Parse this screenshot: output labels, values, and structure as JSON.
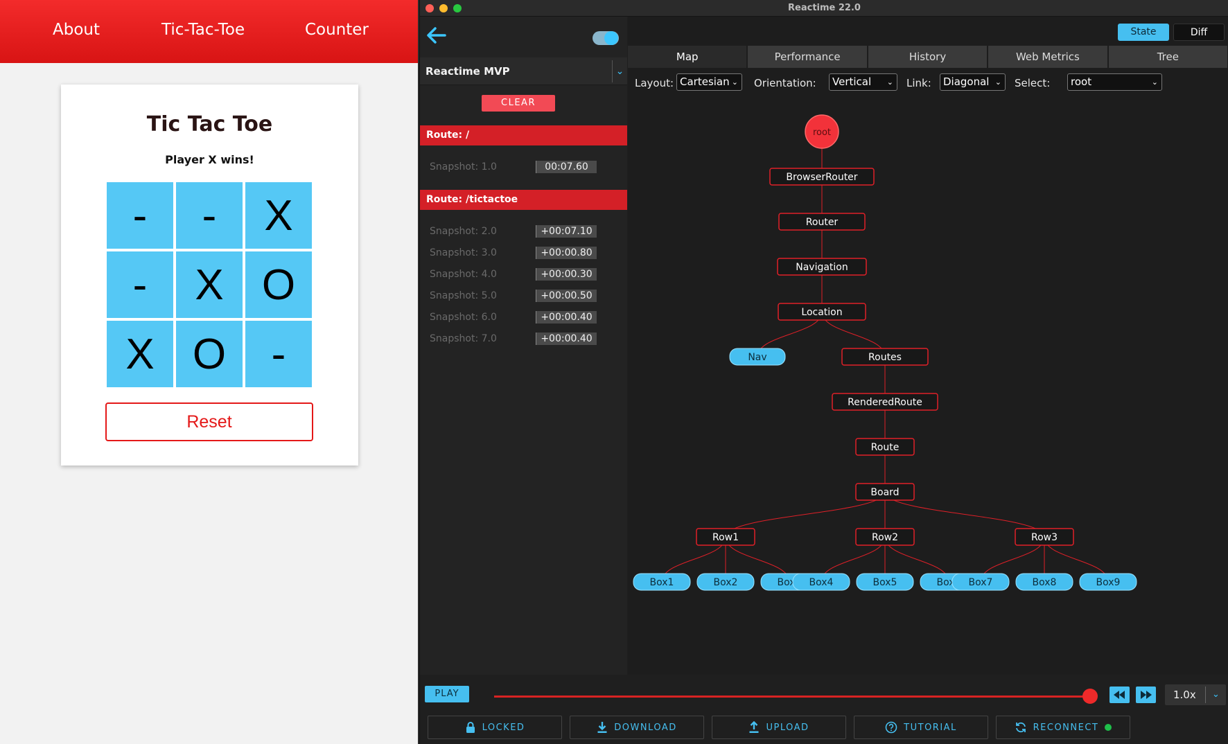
{
  "app": {
    "nav": [
      "About",
      "Tic-Tac-Toe",
      "Counter"
    ],
    "title": "Tic Tac Toe",
    "status": "Player X wins!",
    "board": [
      "-",
      "-",
      "X",
      "-",
      "X",
      "O",
      "X",
      "O",
      "-"
    ],
    "reset_label": "Reset"
  },
  "devtools": {
    "window_title": "Reactime 22.0",
    "app_name": "Reactime MVP",
    "clear_label": "CLEAR",
    "routes": [
      {
        "label": "Route: /",
        "snapshots": [
          {
            "label": "Snapshot: 1.0",
            "time": "00:07.60"
          }
        ]
      },
      {
        "label": "Route: /tictactoe",
        "snapshots": [
          {
            "label": "Snapshot: 2.0",
            "time": "+00:07.10"
          },
          {
            "label": "Snapshot: 3.0",
            "time": "+00:00.80"
          },
          {
            "label": "Snapshot: 4.0",
            "time": "+00:00.30"
          },
          {
            "label": "Snapshot: 5.0",
            "time": "+00:00.50"
          },
          {
            "label": "Snapshot: 6.0",
            "time": "+00:00.40"
          },
          {
            "label": "Snapshot: 7.0",
            "time": "+00:00.40"
          }
        ]
      }
    ],
    "top_buttons": {
      "state": "State",
      "diff": "Diff"
    },
    "tabs": [
      "Map",
      "Performance",
      "History",
      "Web Metrics",
      "Tree"
    ],
    "active_tab": "Map",
    "controls": {
      "layout_label": "Layout:",
      "layout_value": "Cartesian",
      "orientation_label": "Orientation:",
      "orientation_value": "Vertical",
      "link_label": "Link:",
      "link_value": "Diagonal",
      "select_label": "Select:",
      "select_value": "root"
    },
    "tree": {
      "root": "root",
      "chain": [
        "BrowserRouter",
        "Router",
        "Navigation",
        "Location"
      ],
      "location_children": [
        "Nav",
        "Routes"
      ],
      "routes_chain": [
        "RenderedRoute",
        "Route",
        "Board"
      ],
      "rows": [
        "Row1",
        "Row2",
        "Row3"
      ],
      "boxes": [
        "Box1",
        "Box2",
        "Box3",
        "Box4",
        "Box5",
        "Box6",
        "Box7",
        "Box8",
        "Box9"
      ]
    },
    "play_label": "PLAY",
    "timeline_progress": 1.0,
    "speed": "1.0x",
    "bottom_buttons": [
      "LOCKED",
      "DOWNLOAD",
      "UPLOAD",
      "TUTORIAL",
      "RECONNECT"
    ],
    "colors": {
      "accent": "#46bff0",
      "red": "#e02028",
      "connected": "#1fbf4a"
    }
  }
}
